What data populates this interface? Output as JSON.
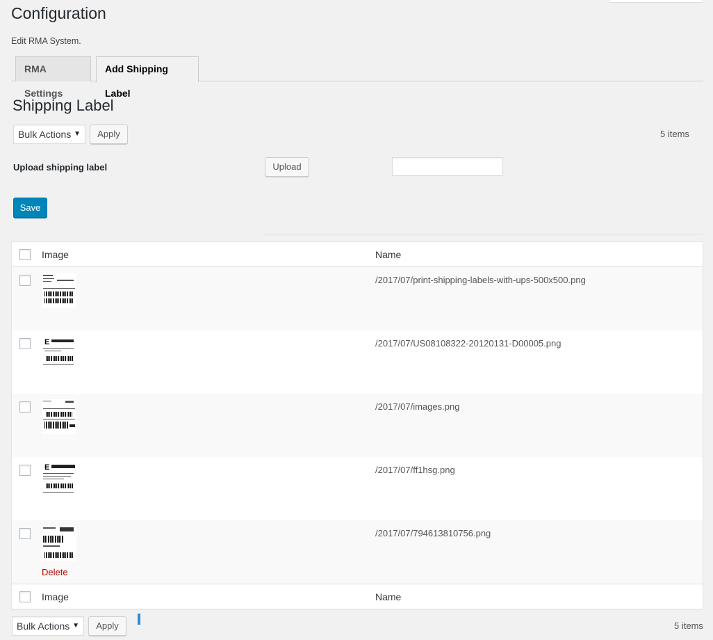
{
  "page": {
    "title": "Configuration",
    "description": "Edit RMA System."
  },
  "tabs": [
    {
      "label": "RMA Settings",
      "active": false
    },
    {
      "label": "Add Shipping Label",
      "active": true
    }
  ],
  "section": {
    "title": "Shipping Label"
  },
  "top_actions": {
    "bulk_select": "Bulk Actions",
    "apply_label": "Apply",
    "items_count": "5 items"
  },
  "upload": {
    "label": "Upload shipping label",
    "button": "Upload",
    "value": ""
  },
  "save_label": "Save",
  "table": {
    "columns": [
      "Image",
      "Name"
    ],
    "rows": [
      {
        "name": "/2017/07/print-shipping-labels-with-ups-500x500.png"
      },
      {
        "name": "/2017/07/US08108322-20120131-D00005.png"
      },
      {
        "name": "/2017/07/images.png"
      },
      {
        "name": "/2017/07/ff1hsg.png"
      },
      {
        "name": "/2017/07/794613810756.png",
        "action": "Delete"
      }
    ]
  },
  "bottom_actions": {
    "bulk_select": "Bulk Actions",
    "apply_label": "Apply",
    "items_count": "5 items"
  },
  "colors": {
    "primary": "#0085ba",
    "delete": "#aa0000",
    "background": "#f1f1f1"
  }
}
